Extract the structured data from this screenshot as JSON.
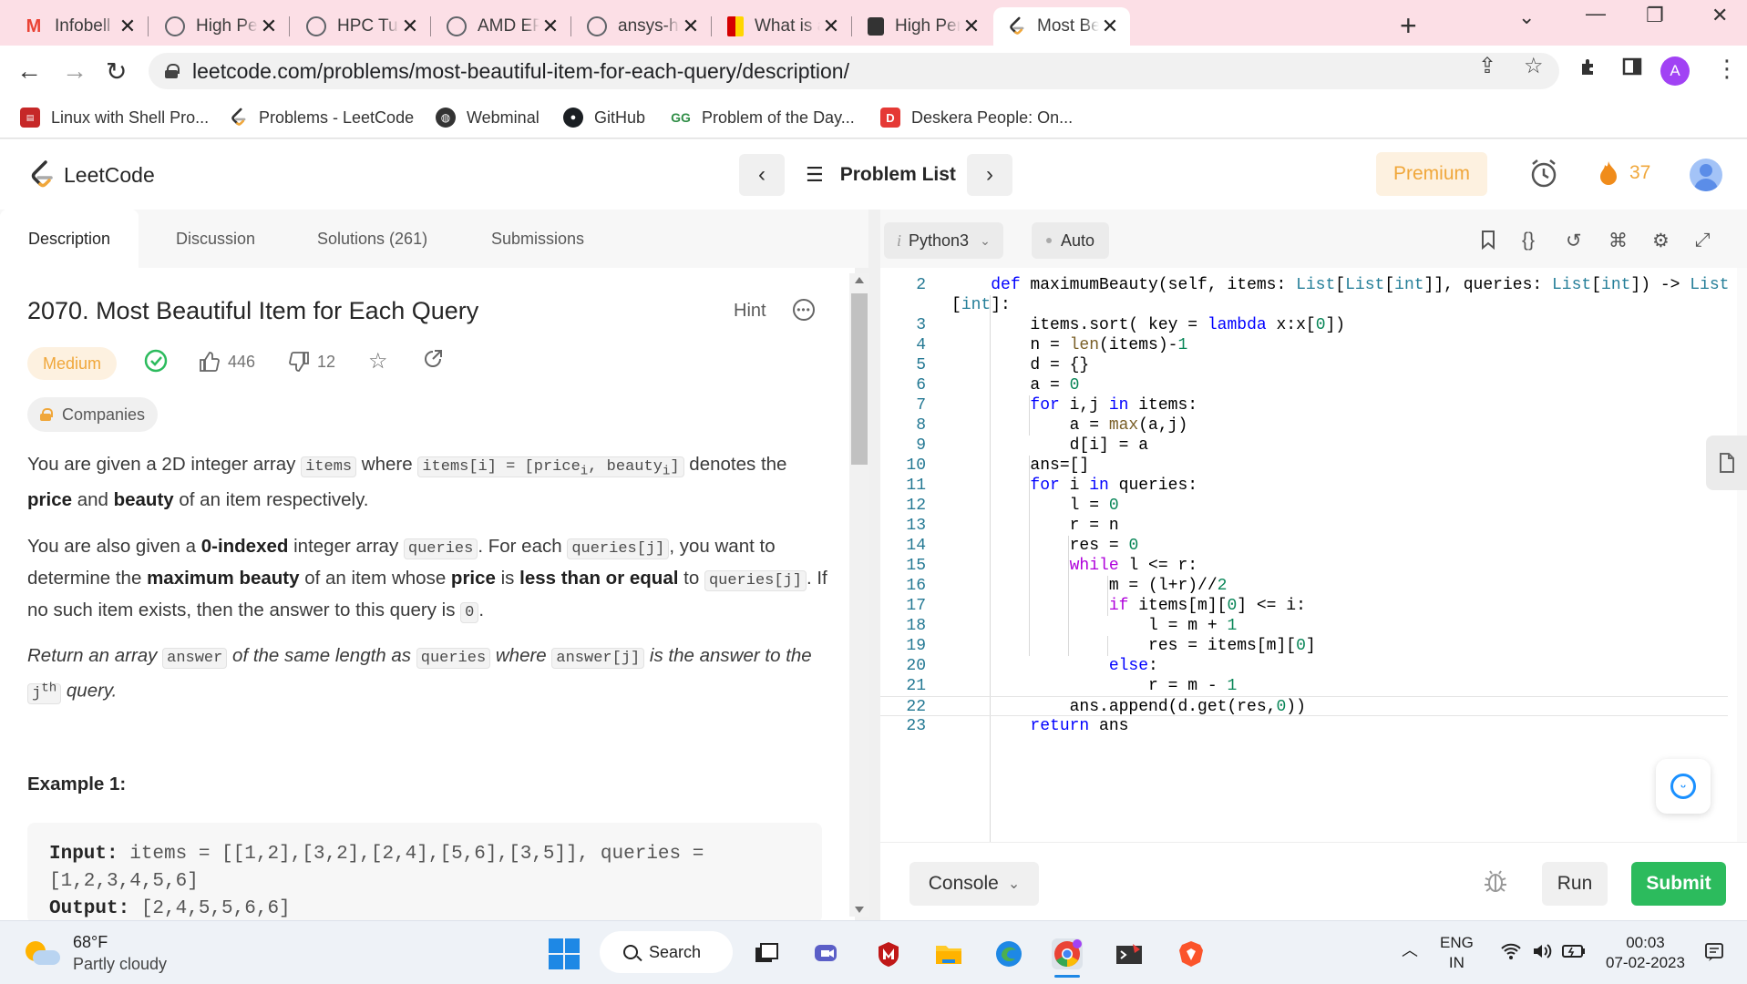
{
  "browser": {
    "tabs": [
      {
        "title": "Infobell IT S",
        "favicon": "gmail-icon",
        "color": "#ea4335",
        "glyph": "M"
      },
      {
        "title": "High Perfor",
        "favicon": "globe-icon",
        "color": "#5f6368",
        "glyph": ""
      },
      {
        "title": "HPC Tuning",
        "favicon": "globe-icon",
        "color": "#5f6368",
        "glyph": ""
      },
      {
        "title": "AMD EPYC",
        "favicon": "globe-icon",
        "color": "#5f6368",
        "glyph": ""
      },
      {
        "title": "ansys-high",
        "favicon": "globe-icon",
        "color": "#5f6368",
        "glyph": ""
      },
      {
        "title": "What is an",
        "favicon": "bookmark-red-icon",
        "color": "#d50000",
        "glyph": ""
      },
      {
        "title": "High Perf. L",
        "favicon": "book-icon",
        "color": "#333333",
        "glyph": ""
      },
      {
        "title": "Most Beaut",
        "favicon": "leetcode-icon",
        "color": "#f0a73b",
        "glyph": ""
      }
    ],
    "url": "leetcode.com/problems/most-beautiful-item-for-each-query/description/",
    "profile_initial": "A",
    "bookmarks": [
      {
        "label": "Linux with Shell Pro...",
        "icon": "linux-icon"
      },
      {
        "label": "Problems - LeetCode",
        "icon": "leetcode-icon"
      },
      {
        "label": "Webminal",
        "icon": "globe-icon"
      },
      {
        "label": "GitHub",
        "icon": "github-icon"
      },
      {
        "label": "Problem of the Day...",
        "icon": "gfg-icon"
      },
      {
        "label": "Deskera People: On...",
        "icon": "deskera-icon"
      }
    ]
  },
  "header": {
    "logo": "LeetCode",
    "problem_list": "Problem List",
    "premium": "Premium",
    "streak": "37"
  },
  "description": {
    "tabs": [
      "Description",
      "Discussion",
      "Solutions (261)",
      "Submissions"
    ],
    "title": "2070. Most Beautiful Item for Each Query",
    "hint": "Hint",
    "difficulty": "Medium",
    "likes": "446",
    "dislikes": "12",
    "companies": "Companies",
    "example_heading": "Example 1:",
    "example_input_label": "Input:",
    "example_input": " items = [[1,2],[3,2],[2,4],[5,6],[3,5]], queries =",
    "example_input_cont": "[1,2,3,4,5,6]",
    "example_output_label": "Output:",
    "example_output": " [2,4,5,5,6,6]"
  },
  "editor": {
    "language": "Python3",
    "mode": "Auto",
    "console": "Console",
    "run": "Run",
    "submit": "Submit",
    "lines": [
      {
        "n": "2",
        "text": "    def maximumBeauty(self, items: List[List[int]], queries: List[int]) -> List"
      },
      {
        "n": "",
        "text": "[int]:"
      },
      {
        "n": "3",
        "text": "        items.sort( key = lambda x:x[0])"
      },
      {
        "n": "4",
        "text": "        n = len(items)-1"
      },
      {
        "n": "5",
        "text": "        d = {}"
      },
      {
        "n": "6",
        "text": "        a = 0"
      },
      {
        "n": "7",
        "text": "        for i,j in items:"
      },
      {
        "n": "8",
        "text": "            a = max(a,j)"
      },
      {
        "n": "9",
        "text": "            d[i] = a"
      },
      {
        "n": "10",
        "text": "        ans=[]"
      },
      {
        "n": "11",
        "text": "        for i in queries:"
      },
      {
        "n": "12",
        "text": "            l = 0"
      },
      {
        "n": "13",
        "text": "            r = n"
      },
      {
        "n": "14",
        "text": "            res = 0"
      },
      {
        "n": "15",
        "text": "            while l <= r:"
      },
      {
        "n": "16",
        "text": "                m = (l+r)//2"
      },
      {
        "n": "17",
        "text": "                if items[m][0] <= i:"
      },
      {
        "n": "18",
        "text": "                    l = m + 1"
      },
      {
        "n": "19",
        "text": "                    res = items[m][0]"
      },
      {
        "n": "20",
        "text": "                else:"
      },
      {
        "n": "21",
        "text": "                    r = m - 1"
      },
      {
        "n": "22",
        "text": "            ans.append(d.get(res,0))"
      },
      {
        "n": "23",
        "text": "        return ans"
      }
    ]
  },
  "taskbar": {
    "temp": "68°F",
    "weather": "Partly cloudy",
    "search": "Search",
    "lang_1": "ENG",
    "lang_2": "IN",
    "time": "00:03",
    "date": "07-02-2023"
  }
}
